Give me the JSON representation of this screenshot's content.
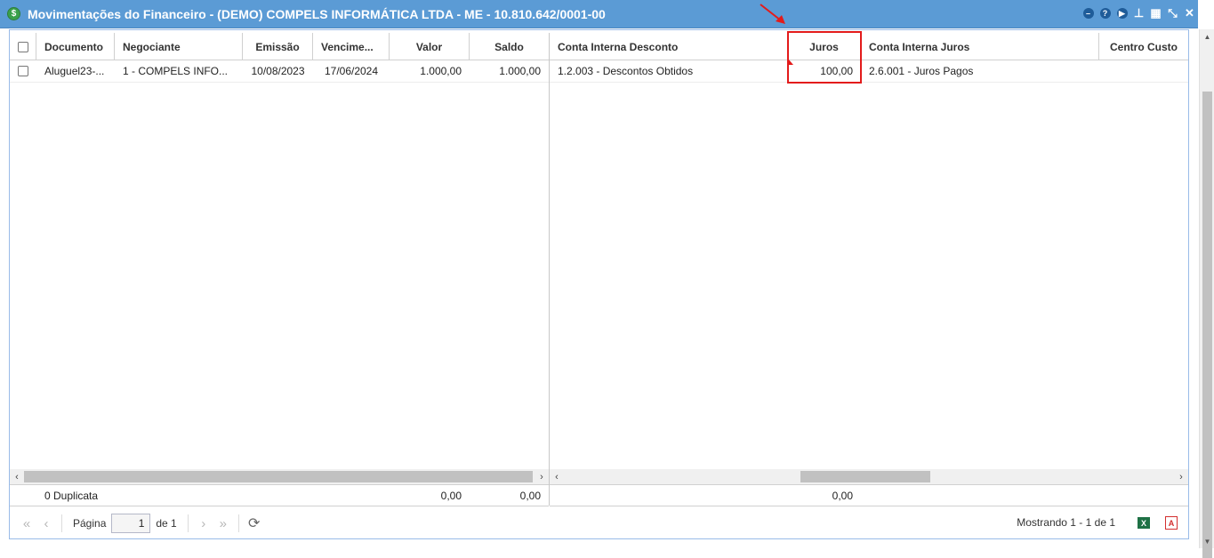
{
  "window": {
    "title": "Movimentações do Financeiro - (DEMO) COMPELS INFORMÁTICA LTDA - ME - 10.810.642/0001-00",
    "app_icon_glyph": "$",
    "tools": [
      "minimize-icon",
      "help-icon",
      "play-icon",
      "stamp-icon",
      "calendar-icon",
      "collapse-icon",
      "close-icon"
    ]
  },
  "grid": {
    "left_columns": [
      "Documento",
      "Negociante",
      "Emissão",
      "Vencime...",
      "Valor",
      "Saldo"
    ],
    "right_columns": [
      "Conta Interna Desconto",
      "Juros",
      "Conta Interna Juros",
      "Centro Custo"
    ],
    "rows": [
      {
        "documento": "Aluguel23-...",
        "negociante": "1 - COMPELS INFO...",
        "emissao": "10/08/2023",
        "vencimento": "17/06/2024",
        "valor": "1.000,00",
        "saldo": "1.000,00",
        "conta_desconto": "1.2.003 - Descontos Obtidos",
        "juros": "100,00",
        "conta_juros": "2.6.001 - Juros Pagos",
        "centro_custo": ""
      }
    ],
    "summary": {
      "label": "0 Duplicata",
      "valor": "0,00",
      "saldo": "0,00",
      "juros": "0,00"
    }
  },
  "pager": {
    "page_label": "Página",
    "page_value": "1",
    "of_label": "de 1",
    "showing": "Mostrando 1 - 1 de 1",
    "excel_glyph": "X",
    "pdf_glyph": "A"
  },
  "colors": {
    "titlebar": "#5b9bd5",
    "highlight": "#e31b1b"
  }
}
